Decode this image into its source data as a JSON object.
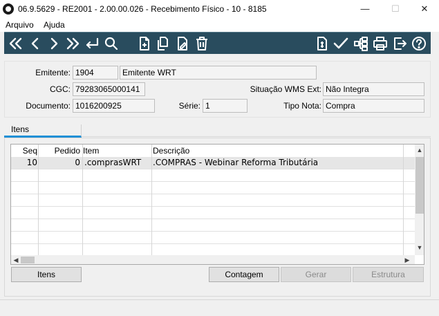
{
  "window": {
    "title": "06.9.5629 - RE2001 - 2.00.00.026 - Recebimento Físico - 10 - 8185",
    "minimize": "—",
    "maximize": "☐",
    "close": "✕"
  },
  "menu": {
    "items": [
      {
        "label": "Arquivo"
      },
      {
        "label": "Ajuda"
      }
    ]
  },
  "toolbar": {
    "icons": [
      "first-icon",
      "previous-icon",
      "next-icon",
      "last-icon",
      "goto-icon",
      "search-icon",
      "new-icon",
      "copy-icon",
      "edit-icon",
      "delete-icon",
      "document-icon",
      "confirm-icon",
      "structure-icon",
      "print-icon",
      "exit-icon",
      "help-icon"
    ],
    "icon_color": "#ffffff",
    "background": "#294c5e"
  },
  "header": {
    "emitente_label": "Emitente:",
    "emitente_code": "1904",
    "emitente_name": "Emitente WRT",
    "cgc_label": "CGC:",
    "cgc_value": "79283065000141",
    "situacao_label": "Situação WMS Ext:",
    "situacao_value": "Não Integra",
    "documento_label": "Documento:",
    "documento_value": "1016200925",
    "serie_label": "Série:",
    "serie_value": "1",
    "tipo_nota_label": "Tipo Nota:",
    "tipo_nota_value": "Compra"
  },
  "tabs": {
    "active": "Itens",
    "active_color": "#1e90d6"
  },
  "grid": {
    "columns": [
      "Seq",
      "Pedido",
      "Item",
      "Descrição"
    ],
    "rows": [
      {
        "seq": "10",
        "pedido": "0",
        "item": ".comprasWRT",
        "descricao": ".COMPRAS - Webinar Reforma Tributária"
      }
    ],
    "scroll_up": "▲",
    "scroll_down": "▼",
    "scroll_left": "◀",
    "scroll_right": "▶"
  },
  "buttons": {
    "itens": "Itens",
    "contagem": "Contagem",
    "gerar": "Gerar",
    "estrutura": "Estrutura"
  }
}
